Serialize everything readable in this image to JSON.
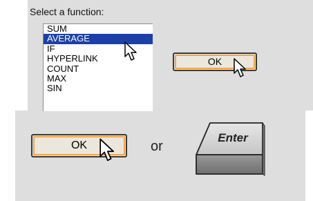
{
  "dialog": {
    "prompt_label": "Select a function:",
    "functions": [
      "SUM",
      "AVERAGE",
      "IF",
      "HYPERLINK",
      "COUNT",
      "MAX",
      "SIN"
    ],
    "selected_function": "AVERAGE",
    "ok_label": "OK"
  },
  "instruction": {
    "ok_label": "OK",
    "connector": "or",
    "enter_key_label": "Enter"
  },
  "colors": {
    "panel_background": "#dedede",
    "selection": "#1c3fa8",
    "button_focus_ring": "#f0a64a"
  }
}
